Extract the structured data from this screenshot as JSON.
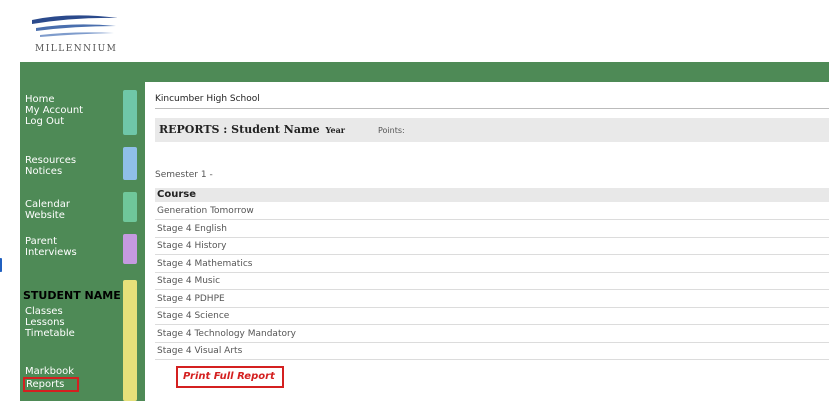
{
  "brand": {
    "name": "MILLENNIUM"
  },
  "colors": {
    "sidebar": "#4e8a56",
    "highlight": "#d42020"
  },
  "sidebar": {
    "groups": [
      {
        "items": [
          "Home",
          "My Account",
          "Log Out"
        ],
        "tab_color": "#6fc7a8"
      },
      {
        "items": [
          "Resources",
          "Notices"
        ],
        "tab_color": "#8fbfe8"
      },
      {
        "items": [
          "Calendar",
          "Website"
        ],
        "tab_color": "#6fc79a"
      },
      {
        "items": [
          "Parent",
          "Interviews"
        ],
        "tab_color": "#c59ae0"
      },
      {
        "items": [
          "Classes",
          "Lessons",
          "Timetable"
        ],
        "tab_color": "#e6e07a"
      },
      {
        "items": [
          "Markbook",
          "Reports"
        ]
      }
    ],
    "student_name": "STUDENT NAME"
  },
  "main": {
    "school_name": "Kincumber High School",
    "reports_title": "REPORTS : Student Name",
    "year_label": "Year",
    "points_label": "Points:",
    "semester": "Semester 1 -",
    "course_header": "Course",
    "courses": [
      "Generation Tomorrow",
      "Stage 4 English",
      "Stage 4 History",
      "Stage 4 Mathematics",
      "Stage 4 Music",
      "Stage 4 PDHPE",
      "Stage 4 Science",
      "Stage 4 Technology Mandatory",
      "Stage 4 Visual Arts"
    ],
    "print_link": "Print Full Report"
  }
}
